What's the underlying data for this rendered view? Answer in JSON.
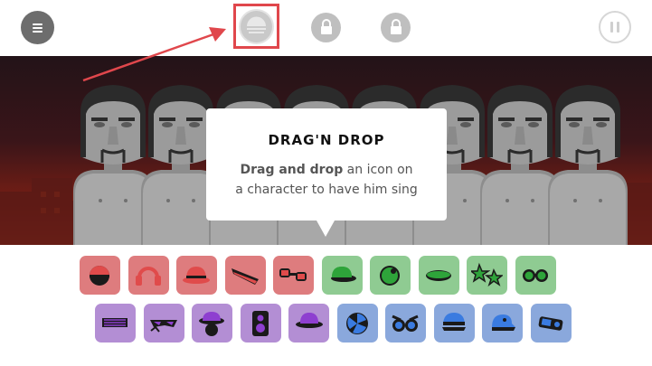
{
  "tooltip": {
    "title": "DRAG'N DROP",
    "body_strong": "Drag and drop",
    "body_rest_1": " an icon on",
    "body_line2": "a character to have him sing"
  },
  "colors": {
    "beats": "#de7c7e",
    "effects": "#8fcb92",
    "melodies": "#b38ed4",
    "voices": "#8aa8dc",
    "highlight": "#e0474c"
  },
  "toolbar": {
    "menu_icon": "hamburger-icon",
    "active_slot_icon": "sound-slot-icon",
    "locked_icon": "lock-icon",
    "pause_icon": "pause-icon"
  },
  "sound_rows": {
    "row1": [
      {
        "name": "beat-1-icon",
        "group": "beats"
      },
      {
        "name": "beat-2-icon",
        "group": "beats"
      },
      {
        "name": "beat-3-icon",
        "group": "beats"
      },
      {
        "name": "beat-4-icon",
        "group": "beats"
      },
      {
        "name": "beat-5-icon",
        "group": "beats"
      },
      {
        "name": "effect-1-icon",
        "group": "effects"
      },
      {
        "name": "effect-2-icon",
        "group": "effects"
      },
      {
        "name": "effect-3-icon",
        "group": "effects"
      },
      {
        "name": "effect-4-icon",
        "group": "effects"
      },
      {
        "name": "effect-5-icon",
        "group": "effects"
      }
    ],
    "row2": [
      {
        "name": "melody-1-icon",
        "group": "melodies"
      },
      {
        "name": "melody-2-icon",
        "group": "melodies"
      },
      {
        "name": "melody-3-icon",
        "group": "melodies"
      },
      {
        "name": "melody-4-icon",
        "group": "melodies"
      },
      {
        "name": "melody-5-icon",
        "group": "melodies"
      },
      {
        "name": "voice-1-icon",
        "group": "voices"
      },
      {
        "name": "voice-2-icon",
        "group": "voices"
      },
      {
        "name": "voice-3-icon",
        "group": "voices"
      },
      {
        "name": "voice-4-icon",
        "group": "voices"
      },
      {
        "name": "voice-5-icon",
        "group": "voices"
      }
    ]
  }
}
